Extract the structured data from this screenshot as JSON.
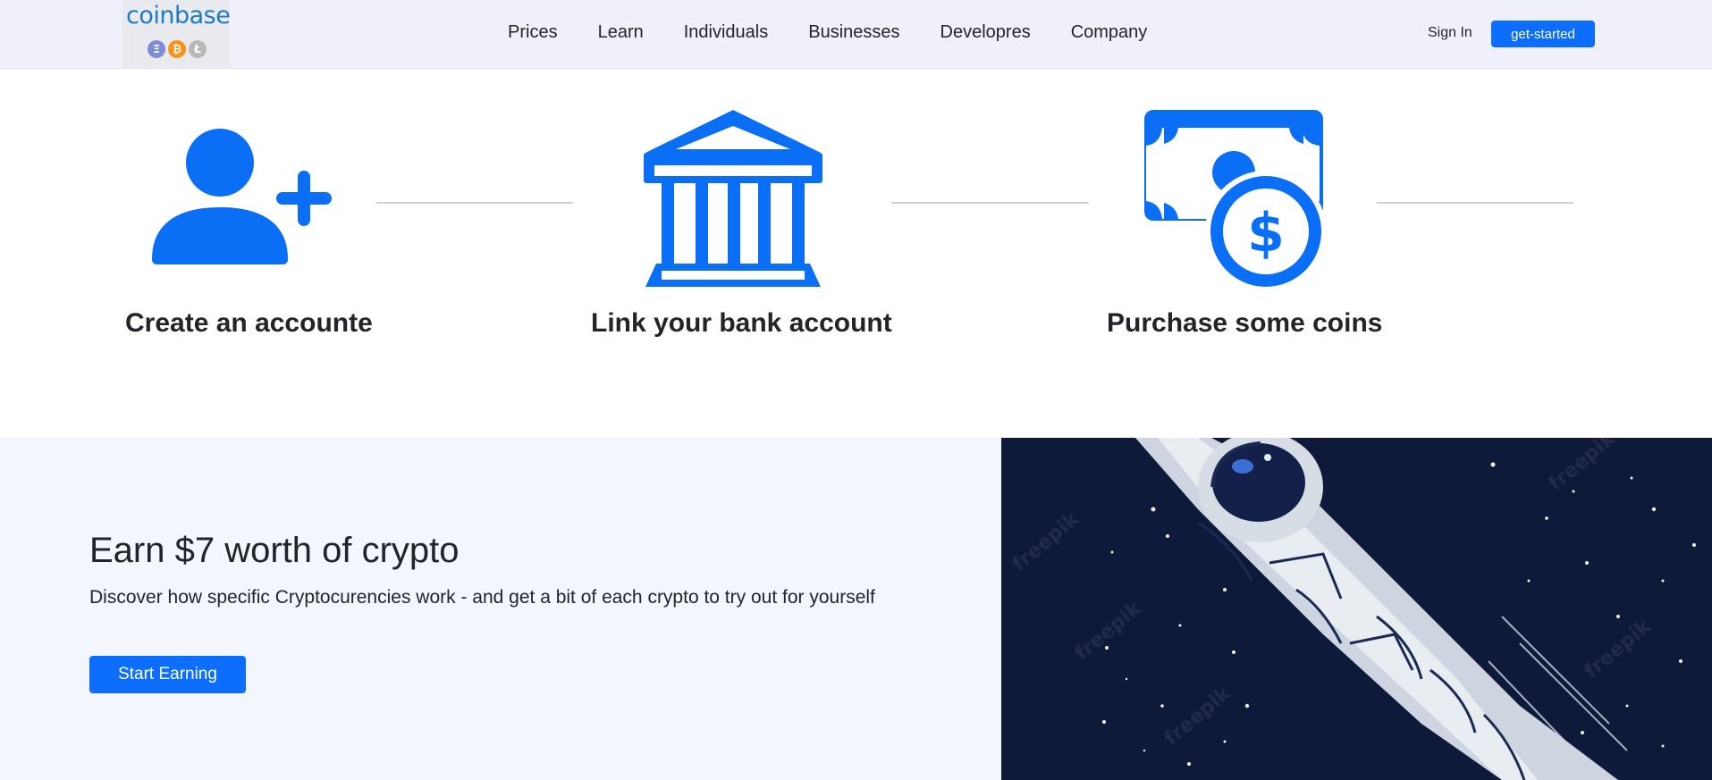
{
  "brand": {
    "logo_text": "coinbase",
    "coins": [
      "Ξ",
      "₿",
      "Ł"
    ]
  },
  "nav": {
    "links": [
      "Prices",
      "Learn",
      "Individuals",
      "Businesses",
      "Developres",
      "Company"
    ],
    "sign_in": "Sign In",
    "get_started": "get-started"
  },
  "steps": [
    {
      "title": "Create an accounte",
      "icon": "add-user-icon"
    },
    {
      "title": "Link your bank account",
      "icon": "bank-icon"
    },
    {
      "title": "Purchase some coins",
      "icon": "money-coin-icon"
    }
  ],
  "earn": {
    "title": "Earn $7 worth of crypto",
    "description": "Discover how specific Cryptocurencies work - and get a bit of each crypto to try out for yourself",
    "button": "Start Earning"
  },
  "hero_image": {
    "watermark": "freepik"
  },
  "colors": {
    "accent": "#0d6efd",
    "icon_blue": "#0b6ff5",
    "navbar_bg": "#eff0fa",
    "space_bg": "#0f1a3a"
  }
}
